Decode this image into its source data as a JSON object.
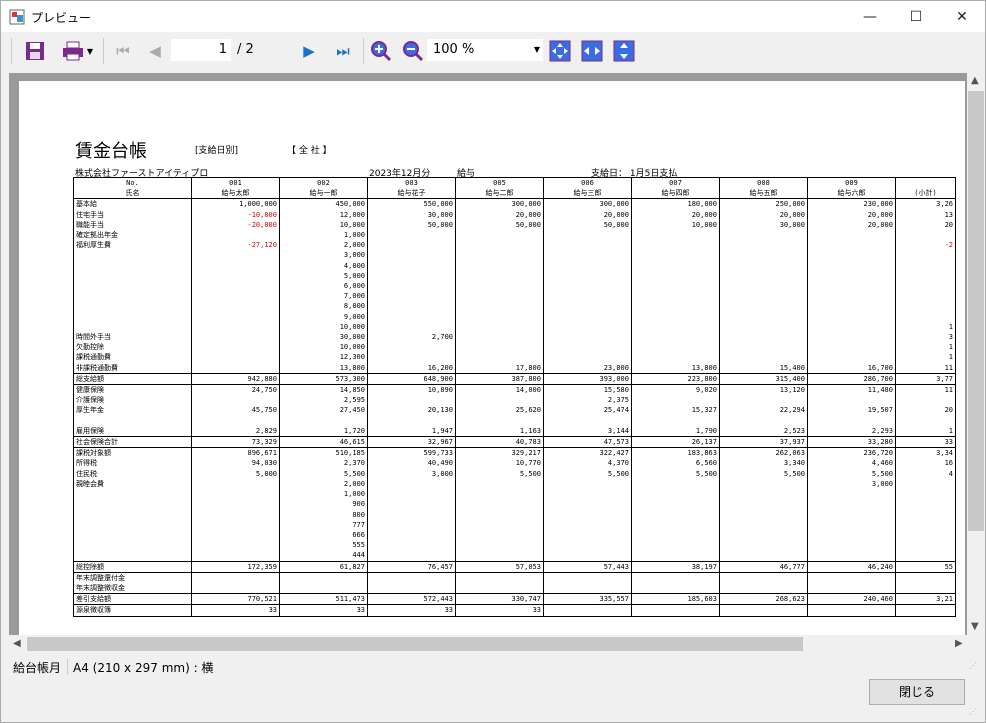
{
  "window": {
    "title": "プレビュー",
    "min": "—",
    "max": "☐",
    "close": "✕"
  },
  "toolbar": {
    "page": "1",
    "page_total": "/ 2",
    "zoom": "100 %"
  },
  "colors": {
    "accent": "#7a2a8a",
    "nav_blue": "#1a73c8"
  },
  "report": {
    "title": "賃金台帳",
    "subtitle1": "[支給日別]",
    "subtitle2": "【 全  社 】",
    "company": "株式会社ファーストアイティプロ",
    "period": "2023年12月分",
    "type": "給与",
    "payday": "支給日： 1月5日支払",
    "head_left": "No.\n氏名",
    "employees": [
      {
        "no": "001",
        "name": "給与太郎"
      },
      {
        "no": "002",
        "name": "給与一郎"
      },
      {
        "no": "003",
        "name": "給与花子"
      },
      {
        "no": "005",
        "name": "給与二郎"
      },
      {
        "no": "006",
        "name": "給与三郎"
      },
      {
        "no": "007",
        "name": "給与四郎"
      },
      {
        "no": "008",
        "name": "給与五郎"
      },
      {
        "no": "009",
        "name": "給与六郎"
      },
      {
        "no": "",
        "name": "(小計)"
      }
    ],
    "sections": [
      {
        "labels": "基本給\n住宅手当\n職能手当\n確定拠出年金\n福利厚生費\n\n\n\n\n\n\n\n\n時間外手当\n欠勤控除\n課税通勤費\n非課税通勤費",
        "cols": [
          "1,000,000\n-10,000\n-20,000\n\n-27,120",
          "450,000\n12,000\n10,000\n1,000\n2,000\n3,000\n4,000\n5,000\n6,000\n7,000\n8,000\n9,000\n10,000\n30,000\n10,000\n12,300\n13,800",
          "550,000\n30,000\n50,000\n\n\n\n\n\n\n\n\n\n\n2,700\n\n\n16,200",
          "300,000\n20,000\n50,000\n\n\n\n\n\n\n\n\n\n\n\n\n\n17,800",
          "300,000\n20,000\n50,000\n\n\n\n\n\n\n\n\n\n\n\n\n\n23,000",
          "180,000\n20,000\n10,000\n\n\n\n\n\n\n\n\n\n\n\n\n\n13,800",
          "250,000\n20,000\n30,000\n\n\n\n\n\n\n\n\n\n\n\n\n\n15,400",
          "230,000\n20,000\n20,000\n\n\n\n\n\n\n\n\n\n\n\n\n\n16,700",
          "3,26\n13\n20\n\n-2\n\n\n\n\n\n\n\n1\n3\n1\n1\n11"
        ]
      },
      {
        "labels": "総支給額",
        "cols": [
          "942,880",
          "573,300",
          "648,900",
          "387,800",
          "393,000",
          "223,800",
          "315,400",
          "286,700",
          "3,77"
        ]
      },
      {
        "labels": "健康保険\n介護保険\n厚生年金\n\n雇用保険",
        "cols": [
          "24,750\n\n45,750\n\n2,829",
          "14,850\n2,595\n27,450\n\n1,720",
          "10,890\n\n20,130\n\n1,947",
          "14,000\n\n25,620\n\n1,163",
          "15,580\n2,375\n25,474\n\n3,144",
          "9,020\n\n15,327\n\n1,790",
          "13,120\n\n22,294\n\n2,523",
          "11,480\n\n19,507\n\n2,293",
          "11\n\n20\n\n1"
        ]
      },
      {
        "labels": "社会保険合計",
        "cols": [
          "73,329",
          "46,615",
          "32,967",
          "40,783",
          "47,573",
          "26,137",
          "37,937",
          "33,280",
          "33"
        ]
      },
      {
        "labels": "課税対象額\n所得税\n住民税\n親睦会費",
        "cols": [
          "896,671\n94,030\n5,000",
          "510,185\n2,370\n5,500\n2,000\n1,000\n900\n800\n777\n666\n555\n444",
          "599,733\n40,490\n3,000",
          "329,217\n10,770\n5,500",
          "322,427\n4,370\n5,500",
          "183,863\n6,560\n5,500",
          "262,063\n3,340\n5,500",
          "236,720\n4,460\n5,500\n3,000",
          "3,34\n16\n4"
        ]
      },
      {
        "labels": "総控除額",
        "cols": [
          "172,359",
          "61,827",
          "76,457",
          "57,053",
          "57,443",
          "38,197",
          "46,777",
          "46,240",
          "55"
        ]
      },
      {
        "labels": "年末調整還付金\n年末調整徴収金",
        "cols": [
          "",
          "",
          "",
          "",
          "",
          "",
          "",
          "",
          ""
        ]
      },
      {
        "labels": "差引支給額",
        "cols": [
          "770,521",
          "511,473",
          "572,443",
          "330,747",
          "335,557",
          "185,603",
          "268,623",
          "240,460",
          "3,21"
        ]
      },
      {
        "labels": "源泉徴収簿",
        "cols": [
          "33",
          "33",
          "33",
          "33",
          "",
          "",
          "",
          "",
          ""
        ]
      }
    ]
  },
  "status": {
    "left": "給台帳月",
    "right": "A4 (210 x 297 mm) : 横"
  },
  "close_label": "閉じる"
}
